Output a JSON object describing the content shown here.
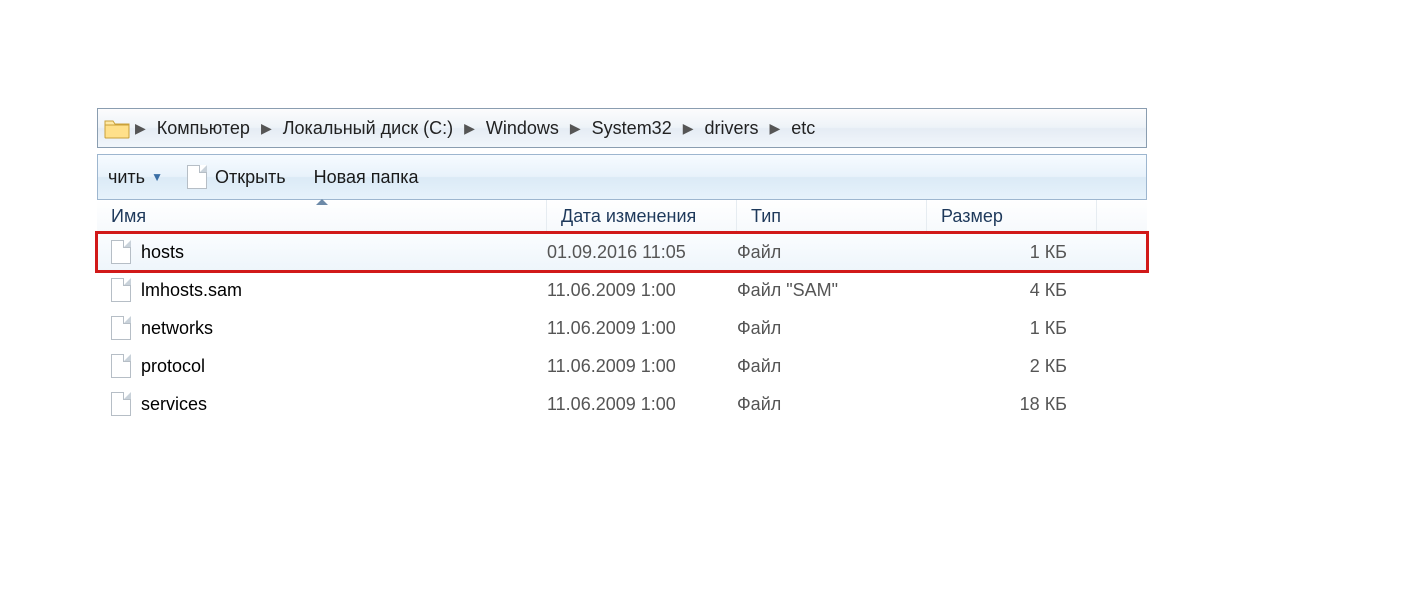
{
  "breadcrumbs": [
    "Компьютер",
    "Локальный диск (C:)",
    "Windows",
    "System32",
    "drivers",
    "etc"
  ],
  "toolbar": {
    "split_left": "чить",
    "open": "Открыть",
    "new_folder": "Новая папка"
  },
  "columns": {
    "name": "Имя",
    "date": "Дата изменения",
    "type": "Тип",
    "size": "Размер"
  },
  "sort": {
    "column": "name",
    "dir": "asc"
  },
  "files": [
    {
      "name": "hosts",
      "date": "01.09.2016 11:05",
      "type": "Файл",
      "size": "1 КБ",
      "selected": true,
      "highlighted": true
    },
    {
      "name": "lmhosts.sam",
      "date": "11.06.2009 1:00",
      "type": "Файл \"SAM\"",
      "size": "4 КБ",
      "selected": false,
      "highlighted": false
    },
    {
      "name": "networks",
      "date": "11.06.2009 1:00",
      "type": "Файл",
      "size": "1 КБ",
      "selected": false,
      "highlighted": false
    },
    {
      "name": "protocol",
      "date": "11.06.2009 1:00",
      "type": "Файл",
      "size": "2 КБ",
      "selected": false,
      "highlighted": false
    },
    {
      "name": "services",
      "date": "11.06.2009 1:00",
      "type": "Файл",
      "size": "18 КБ",
      "selected": false,
      "highlighted": false
    }
  ]
}
